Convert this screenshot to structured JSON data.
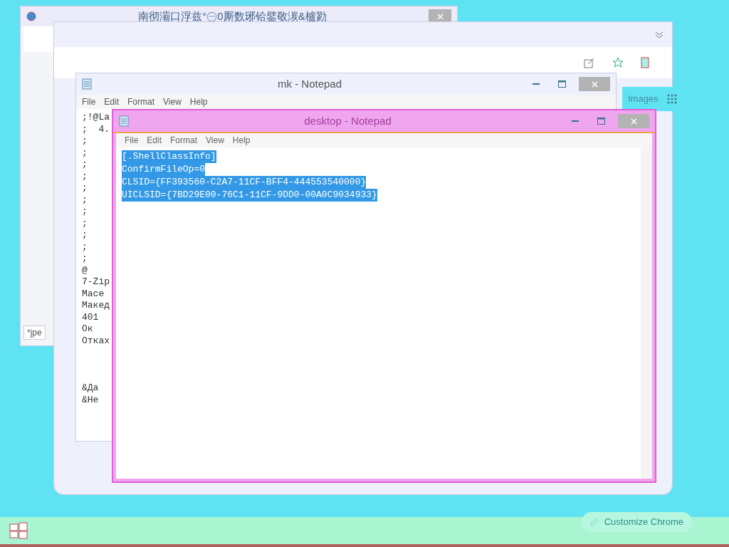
{
  "browser_window": {
    "title": "南彻灞口浮兹°㊀0厮数琊铪鐾敬湠&櫨勠",
    "tab_label": "*jpe"
  },
  "chrome_window": {
    "side_label": "Images",
    "customize_button": "Customize Chrome"
  },
  "back_notepad": {
    "title": "mk - Notepad",
    "menu": [
      "File",
      "Edit",
      "Format",
      "View",
      "Help"
    ],
    "lines": [
      ";!@La",
      ";  4.",
      ";",
      ";",
      ";",
      ";",
      ";",
      ";",
      ";",
      ";",
      ";",
      ";",
      ";",
      "@",
      "7-Zip",
      "Масе",
      "Макед",
      "401",
      "Ок",
      "Отках"
    ],
    "footer_lines": [
      "&Да",
      "&Не"
    ]
  },
  "front_notepad": {
    "title": "desktop - Notepad",
    "menu": [
      "File",
      "Edit",
      "Format",
      "View",
      "Help"
    ],
    "lines": [
      {
        "text": "[.ShellClassInfo]",
        "selected": true
      },
      {
        "text": "ConfirmFileOp=0",
        "selected": true
      },
      {
        "text": "CLSID={FF393560-C2A7-11CF-BFF4-444553540000}",
        "selected": true
      },
      {
        "text": "UICLSID={7BD29E00-76C1-11CF-9DD0-00A0C9034933}",
        "selected": true
      }
    ]
  }
}
